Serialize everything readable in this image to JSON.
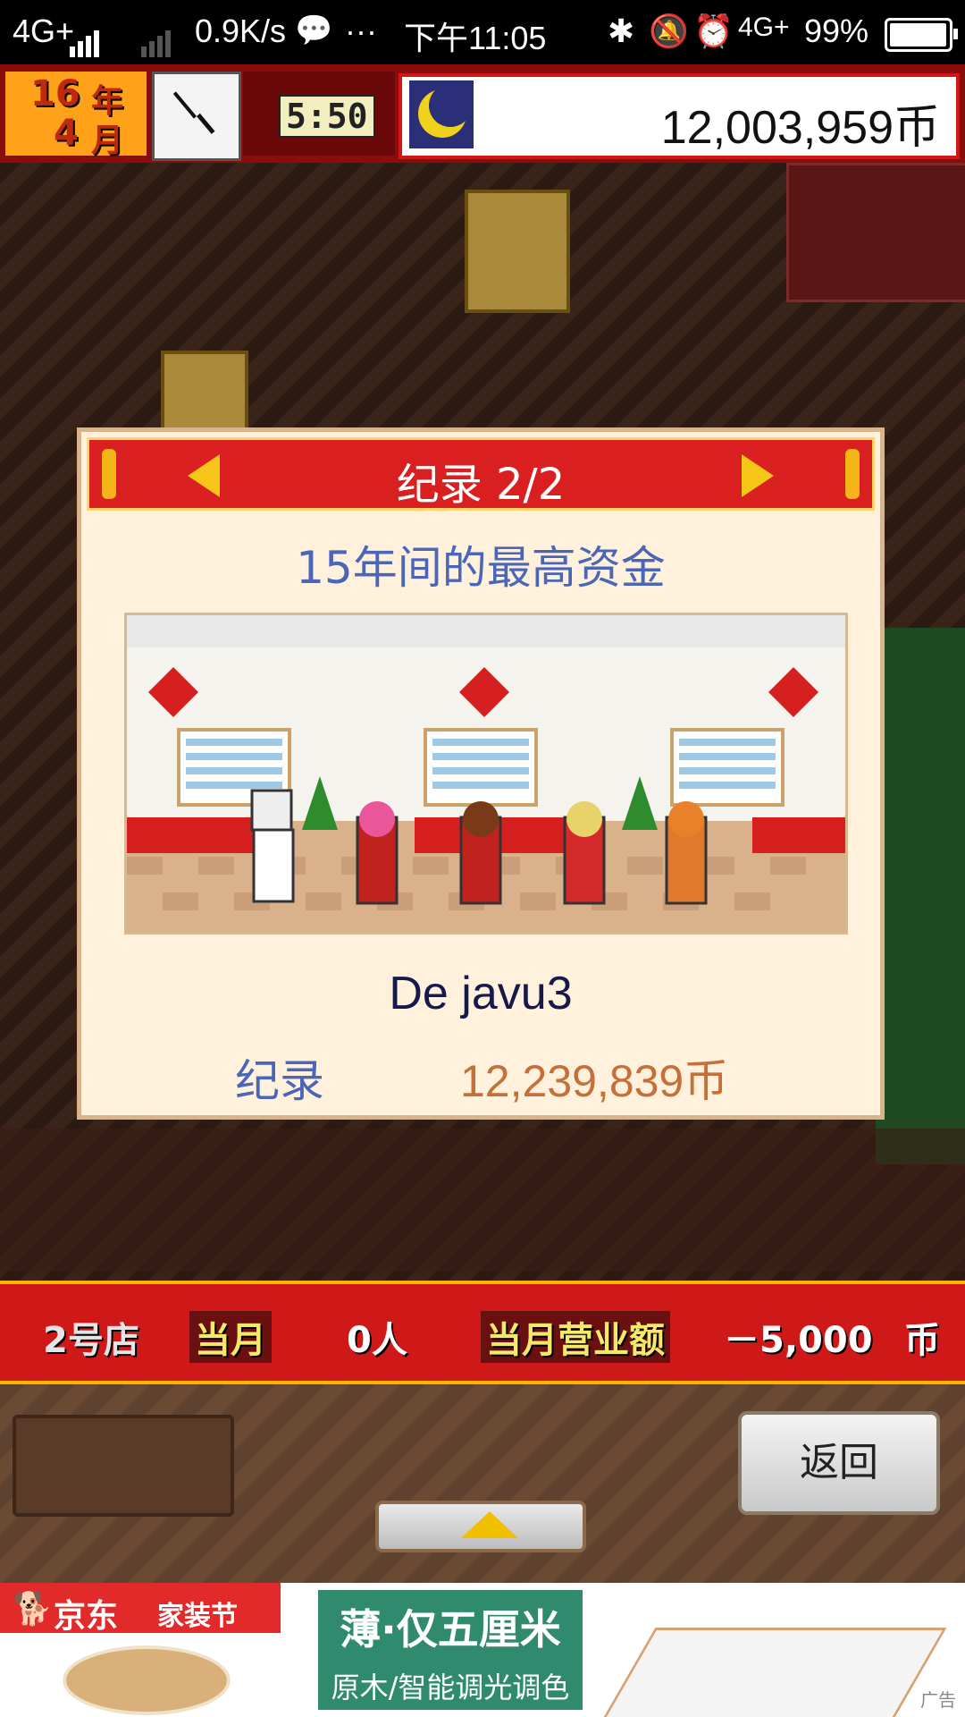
{
  "status_bar": {
    "network_left": "4G+",
    "speed": "0.9K/s",
    "more": "···",
    "time": "下午11:05",
    "network_right": "4G+",
    "battery": "99%",
    "battery_level": 0.99,
    "icons": [
      "wechat-icon",
      "bluetooth-icon",
      "mute-icon",
      "alarm-icon"
    ]
  },
  "hud": {
    "year_num": "16",
    "year_unit": "年",
    "month_num": "4",
    "month_unit": "月",
    "game_time": "5:50",
    "money": "12,003,959币"
  },
  "dialog": {
    "title": "纪录 2/2",
    "subtitle": "15年间的最高资金",
    "player_name": "De javu3",
    "record_label": "纪录",
    "record_value": "12,239,839币"
  },
  "store_bar": {
    "store": "2号店",
    "month_label": "当月",
    "visitors": "0人",
    "revenue_label": "当月营业额",
    "revenue_value": "－5,000",
    "currency": "币"
  },
  "panel": {
    "back_label": "返回"
  },
  "ad": {
    "brand1": "京东",
    "brand2": "家装节",
    "line1": "薄·仅五厘米",
    "line2": "原木/智能调光调色",
    "tag": "广告"
  },
  "colors": {
    "header_red": "#d91f1f",
    "dialog_bg": "#fff1dc",
    "subtitle_blue": "#4a66b8",
    "value_orange": "#c4703a"
  }
}
